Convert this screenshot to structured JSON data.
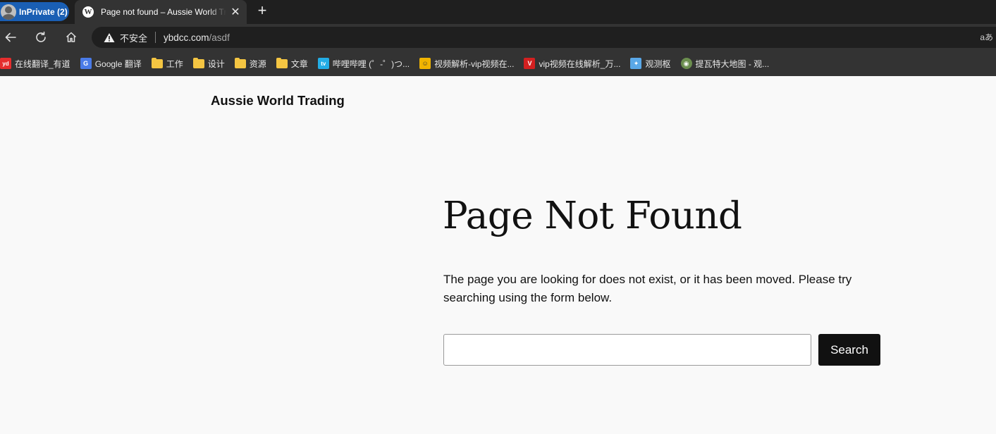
{
  "browser": {
    "private_label": "InPrivate (2)",
    "tab": {
      "title": "Page not found – Aussie World Trading",
      "close_glyph": "✕"
    },
    "new_tab_glyph": "+",
    "address": {
      "security_label": "不安全",
      "url_host": "ybdcc.com",
      "url_path": "/asdf",
      "translate_glyph": "aあ"
    },
    "bookmarks": [
      {
        "label": "在线翻译_有道",
        "icon": "youdao-icon",
        "icon_text": "yd",
        "color": "#e52d2d"
      },
      {
        "label": "Google 翻译",
        "icon": "google-translate-icon",
        "icon_text": "G",
        "color": "#4a7be8"
      },
      {
        "label": "工作",
        "icon": "folder-icon"
      },
      {
        "label": "设计",
        "icon": "folder-icon"
      },
      {
        "label": "资源",
        "icon": "folder-icon"
      },
      {
        "label": "文章",
        "icon": "folder-icon"
      },
      {
        "label": "哔哩哔哩 (゜-゜)つ...",
        "icon": "bilibili-icon",
        "icon_text": "tv",
        "color": "#23ade5"
      },
      {
        "label": "视频解析-vip视频在...",
        "icon": "video-parse-icon",
        "icon_text": "☺",
        "color": "#f0b400"
      },
      {
        "label": "vip视频在线解析_万...",
        "icon": "vip-video-icon",
        "icon_text": "V",
        "color": "#d32020"
      },
      {
        "label": "观测枢",
        "icon": "observatory-icon",
        "icon_text": "✦",
        "color": "#5aa8e8"
      },
      {
        "label": "提瓦特大地图 - 观...",
        "icon": "teyvat-map-icon",
        "icon_text": "◉",
        "color": "#6b8e4e"
      }
    ]
  },
  "page": {
    "site_title": "Aussie World Trading",
    "heading": "Page Not Found",
    "message": "The page you are looking for does not exist, or it has been moved. Please try searching using the form below.",
    "search": {
      "value": "",
      "button_label": "Search"
    }
  }
}
